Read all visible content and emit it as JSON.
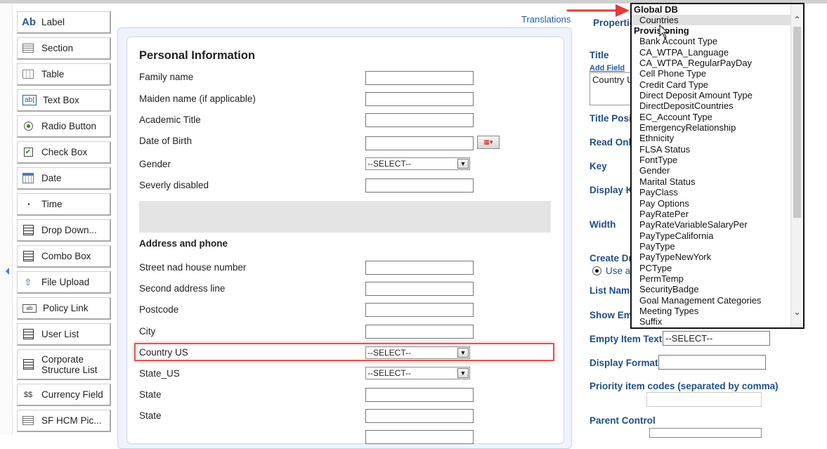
{
  "toolbox": {
    "items": [
      {
        "label": "Label",
        "icon": "label-icon"
      },
      {
        "label": "Section",
        "icon": "section-icon"
      },
      {
        "label": "Table",
        "icon": "table-icon"
      },
      {
        "label": "Text Box",
        "icon": "text-box-icon"
      },
      {
        "label": "Radio Button",
        "icon": "radio-button-icon"
      },
      {
        "label": "Check Box",
        "icon": "check-box-icon"
      },
      {
        "label": "Date",
        "icon": "calendar-icon"
      },
      {
        "label": "Time",
        "icon": "clock-icon"
      },
      {
        "label": "Drop Down...",
        "icon": "drop-down-icon"
      },
      {
        "label": "Combo Box",
        "icon": "combo-box-icon"
      },
      {
        "label": "File Upload",
        "icon": "file-upload-icon"
      },
      {
        "label": "Policy Link",
        "icon": "policy-link-icon"
      },
      {
        "label": "User List",
        "icon": "user-list-icon"
      },
      {
        "label": "Corporate Structure List",
        "icon": "corporate-structure-icon"
      },
      {
        "label": "Currency Field",
        "icon": "currency-icon"
      },
      {
        "label": "SF HCM Pic...",
        "icon": "sf-hcm-icon"
      }
    ],
    "label_icon_text": "Ab",
    "textbox_icon_text": "ab|",
    "policy_icon_text": "ab"
  },
  "form": {
    "translations_link": "Translations",
    "section_title": "Personal Information",
    "address_title": "Address and phone",
    "fields": {
      "family_name": "Family name",
      "maiden_name": "Maiden name (if applicable)",
      "academic_title": "Academic Title",
      "date_of_birth": "Date of Birth",
      "gender": "Gender",
      "severly_disabled": "Severly disabled",
      "street": "Street nad house number",
      "second_address": "Second address line",
      "postcode": "Postcode",
      "city": "City",
      "country_us": "Country US",
      "state_us": "State_US",
      "state1": "State",
      "state2": "State"
    },
    "select_placeholder": "--SELECT--"
  },
  "properties": {
    "properties_label": "Propertie",
    "title_label": "Title",
    "add_field_link": "Add Field",
    "title_value": "Country U",
    "title_position_label": "Title Posi",
    "read_only_label": "Read Onl",
    "key_label": "Key",
    "display_k_label": "Display K",
    "width_label": "Width",
    "create_dr_label": "Create Dr",
    "use_a_label": "Use a",
    "list_name_label": "List Name",
    "show_em_label": "Show Em",
    "empty_item_text_label": "Empty Item Text",
    "empty_item_text_value": "--SELECT--",
    "display_format_label": "Display Format",
    "priority_label": "Priority item codes (separated by comma)",
    "parent_control_label": "Parent Control"
  },
  "dropdown": {
    "groups": [
      {
        "label": "Global DB",
        "options": [
          "Countries"
        ]
      },
      {
        "label": "Provisioning",
        "options": [
          "Bank Account Type",
          "CA_WTPA_Language",
          "CA_WTPA_RegularPayDay",
          "Cell Phone Type",
          "Credit Card Type",
          "Direct Deposit Amount Type",
          "DirectDepositCountries",
          "EC_Account Type",
          "EmergencyRelationship",
          "Ethnicity",
          "FLSA Status",
          "FontType",
          "Gender",
          "Marital Status",
          "PayClass",
          "Pay Options",
          "PayRatePer",
          "PayRateVariableSalaryPer",
          "PayTypeCalifornia",
          "PayType",
          "PayTypeNewYork",
          "PCType",
          "PermTemp",
          "SecurityBadge",
          "Goal Management Categories",
          "Meeting Types",
          "Suffix"
        ]
      }
    ],
    "selected": "Countries"
  },
  "colors": {
    "link_blue": "#1f5aa8",
    "label_blue": "#1f4e86",
    "highlight_red": "#e05454"
  }
}
